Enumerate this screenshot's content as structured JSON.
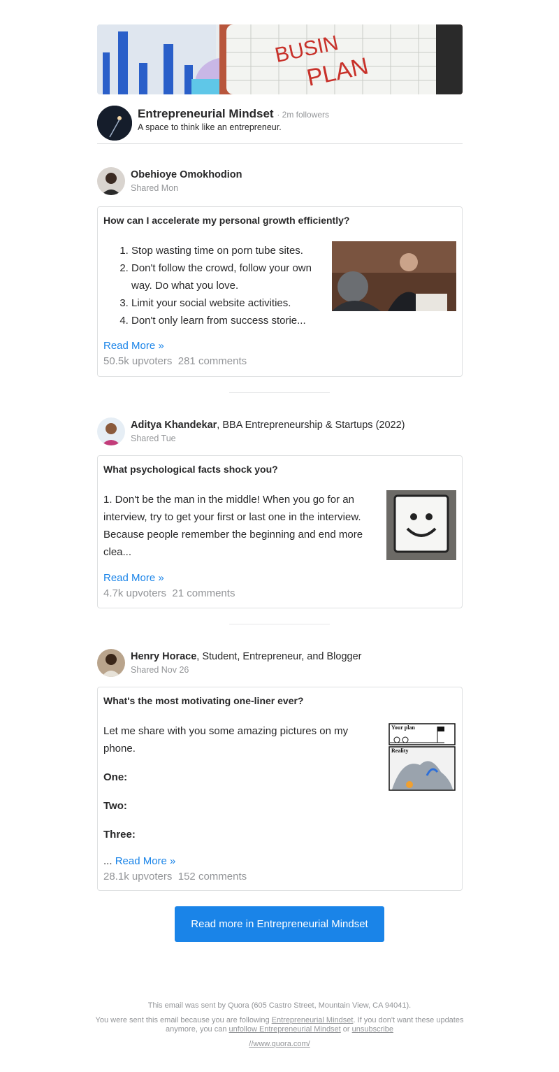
{
  "space": {
    "name": "Entrepreneurial Mindset",
    "followers": "· 2m followers",
    "description": "A space to think like an entrepreneur.",
    "banner_text_1": "BUSIN",
    "banner_text_2": "PLAN"
  },
  "posts": [
    {
      "author_name": "Obehioye Omokhodion",
      "author_credential": "",
      "shared": "Shared Mon",
      "question": "How can I accelerate my personal growth efficiently?",
      "list": [
        "Stop wasting time on porn tube sites.",
        "Don't follow the crowd, follow your own way. Do what you love.",
        "Limit your social website activities.",
        "Don't only learn from success storie..."
      ],
      "read_more": "Read More »",
      "upvoters": "50.5k upvoters",
      "comments": "281 comments"
    },
    {
      "author_name": "Aditya Khandekar",
      "author_credential": ", BBA Entrepreneurship & Startups (2022)",
      "shared": "Shared Tue",
      "question": "What psychological facts shock you?",
      "text": "1. Don't be the man in the middle! When you go for an interview, try to get your first or last one in the interview. Because people remember the beginning and end more clea...",
      "read_more": "Read More »",
      "upvoters": "4.7k upvoters",
      "comments": "21 comments"
    },
    {
      "author_name": "Henry Horace",
      "author_credential": ", Student, Entrepreneur, and Blogger",
      "shared": "Shared Nov 26",
      "question": "What's the most motivating one-liner ever?",
      "text": "Let me share with you some amazing pictures on my phone.",
      "items": [
        "One:",
        "Two:",
        "Three:"
      ],
      "ellipsis": "...",
      "read_more": "Read More »",
      "upvoters": "28.1k upvoters",
      "comments": "152 comments",
      "thumb_label_1": "Your plan",
      "thumb_label_2": "Reality"
    }
  ],
  "cta": "Read more in Entrepreneurial Mindset",
  "footer": {
    "line1": "This email was sent by Quora (605 Castro Street, Mountain View, CA 94041).",
    "line2_a": "You were sent this email because you are following ",
    "line2_link": "Entrepreneurial Mindset",
    "line2_b": ". If you don't want these updates anymore, you can ",
    "unfollow_link": "unfollow Entrepreneurial Mindset",
    "or": " or ",
    "unsubscribe_link": "unsubscribe",
    "url": "//www.quora.com/"
  },
  "colors": {
    "link": "#1a84e8",
    "cta_bg": "#1a84e8",
    "muted": "#939598",
    "text": "#282829"
  }
}
